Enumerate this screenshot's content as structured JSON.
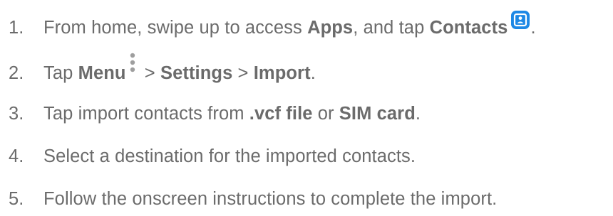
{
  "steps": [
    {
      "number": "1.",
      "text_a": "From home, swipe up to access ",
      "bold_a": "Apps",
      "text_b": ", and tap ",
      "bold_b": "Contacts",
      "icon": "contacts-app-icon",
      "text_c": "."
    },
    {
      "number": "2.",
      "text_a": "Tap ",
      "bold_a": "Menu",
      "icon": "vertical-dots-menu-icon",
      "text_b": " > ",
      "bold_b": "Settings",
      "text_c": " > ",
      "bold_c": "Import",
      "text_d": "."
    },
    {
      "number": "3.",
      "text_a": "Tap import contacts from ",
      "bold_a": ".vcf file",
      "text_b": " or ",
      "bold_b": "SIM card",
      "text_c": "."
    },
    {
      "number": "4.",
      "text_a": "Select a destination for the imported contacts."
    },
    {
      "number": "5.",
      "text_a": "Follow the onscreen instructions to complete the import."
    }
  ],
  "colors": {
    "text": "#6b6b6b",
    "contacts_icon": "#1e88e5",
    "menu_dots": "#9e9e9e"
  }
}
